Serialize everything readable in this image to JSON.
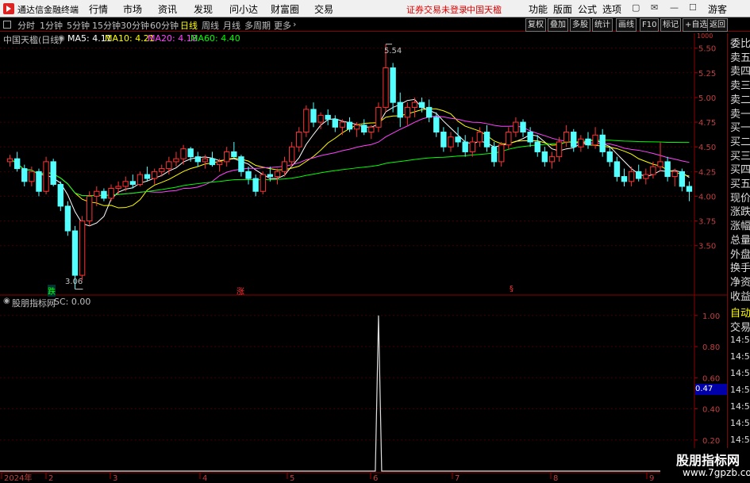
{
  "titlebar": {
    "app_name": "通达信金融终端",
    "menus": [
      "行情",
      "市场",
      "资讯",
      "发现",
      "问小达",
      "财富圈",
      "交易"
    ],
    "warning": "证券交易未登录",
    "stock": "中国天楹",
    "right_menus": [
      "功能",
      "版面",
      "公式",
      "选项"
    ],
    "guest": "游客"
  },
  "toolbar": {
    "periods": [
      "分时",
      "1分钟",
      "5分钟",
      "15分钟",
      "30分钟",
      "60分钟",
      "日线",
      "周线",
      "月线",
      "多周期",
      "更多"
    ],
    "active_period": "日线",
    "right_buttons": [
      "复权",
      "叠加",
      "多股",
      "统计",
      "画线",
      "F10",
      "标记",
      "+自选",
      "返回"
    ]
  },
  "main_chart": {
    "stock_label": "中国天楹(日线)",
    "ma_labels": [
      {
        "text": "MA5: 4.11",
        "color": "#ffffff"
      },
      {
        "text": "MA10: 4.21",
        "color": "#ffff00"
      },
      {
        "text": "MA20: 4.18",
        "color": "#ff44ff"
      },
      {
        "text": "MA60: 4.40",
        "color": "#00ff00"
      }
    ],
    "price_ticks": [
      "5.50",
      "5.25",
      "5.00",
      "4.75",
      "4.50",
      "4.25",
      "4.00",
      "3.75",
      "3.50"
    ],
    "high_label": "5.54",
    "low_label": "3.06",
    "markers": [
      {
        "text": "跌",
        "color": "#00ff00"
      },
      {
        "text": "涨",
        "color": "#ff3333"
      },
      {
        "text": "§",
        "color": "#ff3333"
      }
    ],
    "axis_small": "1000"
  },
  "sub_chart": {
    "label": "股朋指标网",
    "sc_value": "SC: 0.00",
    "ticks": [
      "1.00",
      "0.80",
      "0.60",
      "0.40",
      "0.20"
    ],
    "current_value": "0.47"
  },
  "date_axis": [
    "2024年",
    "2",
    "3",
    "4",
    "5",
    "6",
    "7",
    "8",
    "9"
  ],
  "side_panel": {
    "items": [
      "委比",
      "卖五",
      "卖四",
      "卖三",
      "卖二",
      "卖一",
      "买一",
      "买二",
      "买三",
      "买四",
      "买五",
      "现价",
      "涨跌",
      "涨幅",
      "总量",
      "外盘",
      "换手",
      "净资",
      "收益"
    ],
    "lower_items": [
      "自动",
      "交易"
    ],
    "times": [
      "14:56",
      "14:56",
      "14:56",
      "14:56",
      "14:56",
      "14:56",
      "14:56",
      "14:56",
      "14:56"
    ]
  },
  "watermark": {
    "line1": "股朋指标网",
    "line2": "www.7gpzb.com"
  },
  "chart_data": {
    "type": "candlestick",
    "title": "中国天楹(日线)",
    "ylim": [
      3.0,
      5.65
    ],
    "x_labels": [
      "2024年",
      "2",
      "3",
      "4",
      "5",
      "6",
      "7",
      "8",
      "9"
    ],
    "candles_ohlc": [
      [
        4.35,
        4.42,
        4.3,
        4.38
      ],
      [
        4.38,
        4.45,
        4.25,
        4.28
      ],
      [
        4.28,
        4.32,
        4.1,
        4.15
      ],
      [
        4.15,
        4.3,
        4.1,
        4.25
      ],
      [
        4.25,
        4.28,
        4.0,
        4.05
      ],
      [
        4.05,
        4.4,
        4.02,
        4.35
      ],
      [
        4.35,
        4.38,
        4.1,
        4.12
      ],
      [
        4.12,
        4.15,
        3.85,
        3.9
      ],
      [
        3.9,
        3.95,
        3.6,
        3.65
      ],
      [
        3.65,
        3.7,
        3.06,
        3.2
      ],
      [
        3.2,
        3.8,
        3.15,
        3.75
      ],
      [
        3.75,
        4.05,
        3.7,
        4.0
      ],
      [
        4.0,
        4.1,
        3.9,
        4.05
      ],
      [
        4.05,
        4.08,
        3.95,
        3.98
      ],
      [
        3.98,
        4.12,
        3.95,
        4.08
      ],
      [
        4.08,
        4.15,
        4.02,
        4.1
      ],
      [
        4.1,
        4.2,
        4.05,
        4.15
      ],
      [
        4.15,
        4.22,
        4.08,
        4.12
      ],
      [
        4.12,
        4.25,
        4.1,
        4.22
      ],
      [
        4.22,
        4.3,
        4.15,
        4.18
      ],
      [
        4.18,
        4.28,
        4.12,
        4.25
      ],
      [
        4.25,
        4.32,
        4.2,
        4.28
      ],
      [
        4.28,
        4.4,
        4.22,
        4.35
      ],
      [
        4.35,
        4.45,
        4.3,
        4.38
      ],
      [
        4.38,
        4.52,
        4.32,
        4.48
      ],
      [
        4.48,
        4.5,
        4.35,
        4.4
      ],
      [
        4.4,
        4.45,
        4.3,
        4.35
      ],
      [
        4.35,
        4.42,
        4.28,
        4.38
      ],
      [
        4.38,
        4.45,
        4.3,
        4.32
      ],
      [
        4.32,
        4.38,
        4.25,
        4.35
      ],
      [
        4.35,
        4.5,
        4.3,
        4.45
      ],
      [
        4.45,
        4.55,
        4.38,
        4.4
      ],
      [
        4.4,
        4.42,
        4.2,
        4.25
      ],
      [
        4.25,
        4.3,
        4.12,
        4.18
      ],
      [
        4.18,
        4.22,
        4.0,
        4.05
      ],
      [
        4.05,
        4.25,
        4.02,
        4.22
      ],
      [
        4.22,
        4.3,
        4.15,
        4.2
      ],
      [
        4.2,
        4.28,
        4.12,
        4.25
      ],
      [
        4.25,
        4.4,
        4.2,
        4.35
      ],
      [
        4.35,
        4.55,
        4.3,
        4.5
      ],
      [
        4.5,
        4.7,
        4.45,
        4.65
      ],
      [
        4.65,
        4.92,
        4.6,
        4.88
      ],
      [
        4.88,
        4.95,
        4.7,
        4.75
      ],
      [
        4.75,
        4.85,
        4.68,
        4.82
      ],
      [
        4.82,
        4.88,
        4.72,
        4.78
      ],
      [
        4.78,
        4.82,
        4.65,
        4.7
      ],
      [
        4.7,
        4.78,
        4.62,
        4.75
      ],
      [
        4.75,
        4.8,
        4.65,
        4.68
      ],
      [
        4.68,
        4.75,
        4.6,
        4.72
      ],
      [
        4.72,
        4.78,
        4.62,
        4.65
      ],
      [
        4.65,
        4.72,
        4.58,
        4.7
      ],
      [
        4.7,
        4.95,
        4.65,
        4.9
      ],
      [
        4.9,
        5.54,
        4.85,
        5.3
      ],
      [
        5.3,
        5.35,
        4.85,
        4.95
      ],
      [
        4.95,
        5.05,
        4.7,
        4.8
      ],
      [
        4.8,
        4.95,
        4.72,
        4.9
      ],
      [
        4.9,
        5.0,
        4.8,
        4.95
      ],
      [
        4.95,
        5.0,
        4.85,
        4.9
      ],
      [
        4.9,
        4.98,
        4.75,
        4.8
      ],
      [
        4.8,
        4.85,
        4.6,
        4.65
      ],
      [
        4.65,
        4.7,
        4.45,
        4.5
      ],
      [
        4.5,
        4.65,
        4.45,
        4.6
      ],
      [
        4.6,
        4.7,
        4.5,
        4.55
      ],
      [
        4.55,
        4.62,
        4.4,
        4.45
      ],
      [
        4.45,
        4.6,
        4.4,
        4.55
      ],
      [
        4.55,
        4.7,
        4.5,
        4.65
      ],
      [
        4.65,
        4.72,
        4.45,
        4.5
      ],
      [
        4.5,
        4.55,
        4.3,
        4.35
      ],
      [
        4.35,
        4.55,
        4.3,
        4.52
      ],
      [
        4.52,
        4.7,
        4.48,
        4.65
      ],
      [
        4.65,
        4.8,
        4.6,
        4.75
      ],
      [
        4.75,
        4.78,
        4.6,
        4.65
      ],
      [
        4.65,
        4.7,
        4.5,
        4.55
      ],
      [
        4.55,
        4.62,
        4.4,
        4.45
      ],
      [
        4.45,
        4.5,
        4.3,
        4.35
      ],
      [
        4.35,
        4.45,
        4.28,
        4.4
      ],
      [
        4.4,
        4.6,
        4.35,
        4.55
      ],
      [
        4.55,
        4.72,
        4.5,
        4.65
      ],
      [
        4.65,
        4.68,
        4.45,
        4.5
      ],
      [
        4.5,
        4.62,
        4.45,
        4.58
      ],
      [
        4.58,
        4.65,
        4.48,
        4.52
      ],
      [
        4.52,
        4.7,
        4.48,
        4.62
      ],
      [
        4.62,
        4.68,
        4.4,
        4.45
      ],
      [
        4.45,
        4.5,
        4.3,
        4.35
      ],
      [
        4.35,
        4.4,
        4.15,
        4.2
      ],
      [
        4.2,
        4.28,
        4.1,
        4.15
      ],
      [
        4.15,
        4.3,
        4.1,
        4.25
      ],
      [
        4.25,
        4.32,
        4.15,
        4.18
      ],
      [
        4.18,
        4.28,
        4.12,
        4.22
      ],
      [
        4.22,
        4.35,
        4.18,
        4.3
      ],
      [
        4.3,
        4.55,
        4.25,
        4.35
      ],
      [
        4.35,
        4.4,
        4.15,
        4.2
      ],
      [
        4.2,
        4.28,
        4.1,
        4.25
      ],
      [
        4.25,
        4.28,
        4.05,
        4.1
      ],
      [
        4.1,
        4.15,
        3.95,
        4.05
      ]
    ],
    "sc_series": {
      "spike_index": 51,
      "spike_value": 1.0
    },
    "sub_ylim": [
      0,
      1.05
    ]
  }
}
